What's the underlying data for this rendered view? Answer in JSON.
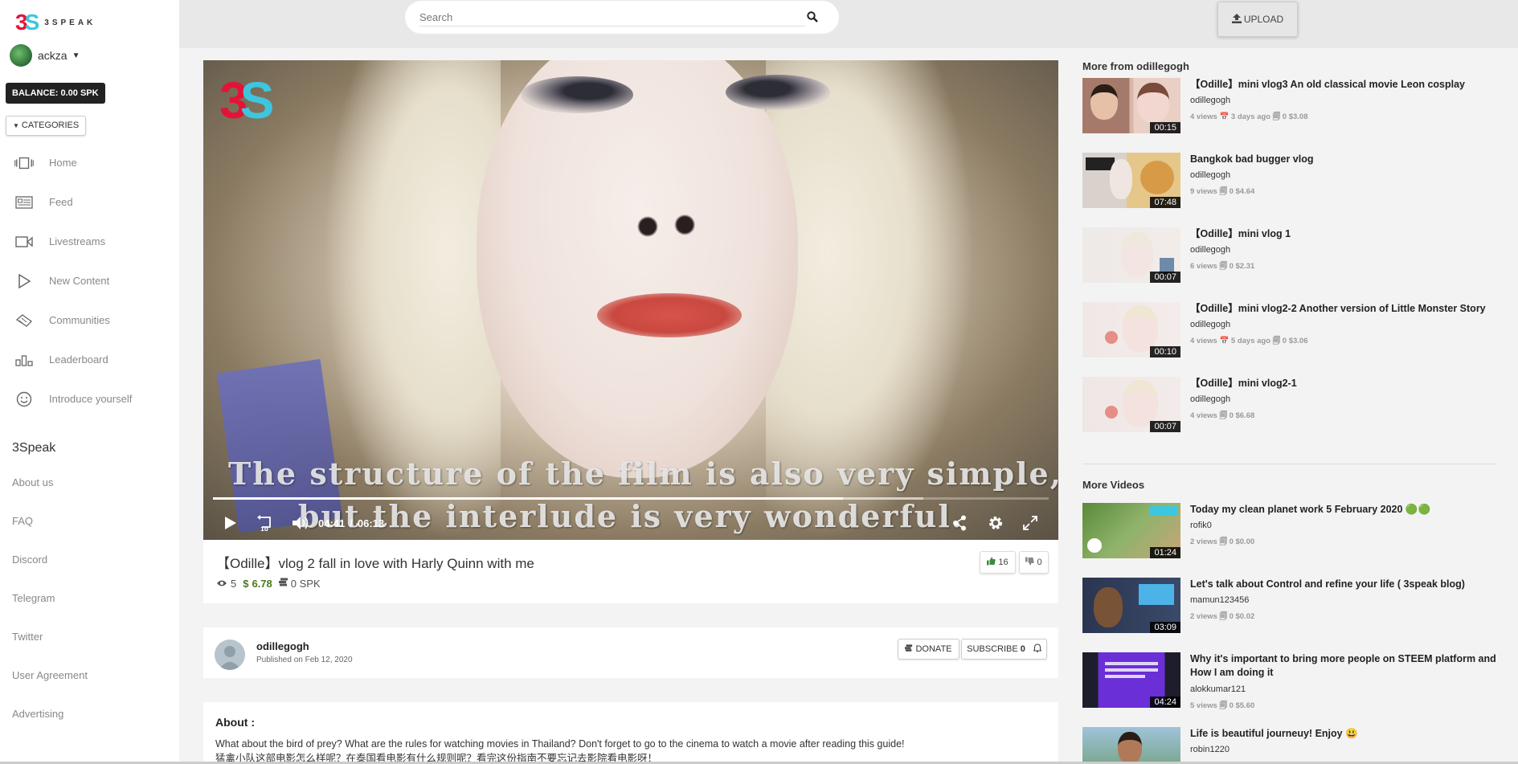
{
  "app": {
    "logo_text": "3SPEAK"
  },
  "user": {
    "name": "ackza"
  },
  "balance_label": "BALANCE: 0.00 SPK",
  "categories_label": "CATEGORIES",
  "nav": [
    {
      "label": "Home",
      "icon": "home-icon"
    },
    {
      "label": "Feed",
      "icon": "feed-icon"
    },
    {
      "label": "Livestreams",
      "icon": "video-camera-icon"
    },
    {
      "label": "New Content",
      "icon": "play-icon"
    },
    {
      "label": "Communities",
      "icon": "communities-icon"
    },
    {
      "label": "Leaderboard",
      "icon": "leaderboard-icon"
    },
    {
      "label": "Introduce yourself",
      "icon": "smiley-icon"
    }
  ],
  "footer": {
    "title": "3Speak",
    "links": [
      "About us",
      "FAQ",
      "Discord",
      "Telegram",
      "Twitter",
      "User Agreement",
      "Advertising"
    ]
  },
  "search": {
    "placeholder": "Search"
  },
  "upload_label": "UPLOAD",
  "player": {
    "subtitle_line1": "The structure of the film is also very simple,",
    "subtitle_line2": "but the interlude is very wonderful.",
    "current_time": "04:41",
    "separator": "/",
    "duration": "06:13",
    "played_fraction": 0.754,
    "buffered_fraction": 0.85
  },
  "video": {
    "title": "【Odille】vlog 2 fall in love with Harly Quinn with me",
    "views": "5",
    "earnings": "6.78",
    "spk": "0 SPK",
    "likes": "16",
    "dislikes": "0"
  },
  "channel": {
    "name": "odillegogh",
    "published": "Published on Feb 12, 2020",
    "donate_label": "DONATE",
    "subscribe_label": "SUBSCRIBE",
    "subscribe_count": "0"
  },
  "about": {
    "title": "About :",
    "line1": "What about the bird of prey? What are the rules for watching movies in Thailand? Don't forget to go to the cinema to watch a movie after reading this guide!",
    "line2": "猛禽小队这部电影怎么样呢？在泰国看电影有什么规则呢？看完这份指南不要忘记去影院看电影呀！"
  },
  "more_from": {
    "title": "More from odillegogh",
    "videos": [
      {
        "title": "【Odille】mini vlog3 An old classical movie Leon cosplay",
        "author": "odillegogh",
        "meta": "4 views 📅 3 days ago 🗐 0  $3.08",
        "duration": "00:15"
      },
      {
        "title": "Bangkok bad bugger vlog",
        "author": "odillegogh",
        "meta": "9 views 🗐 0  $4.64",
        "duration": "07:48"
      },
      {
        "title": "【Odille】mini vlog 1",
        "author": "odillegogh",
        "meta": "6 views 🗐 0  $2.31",
        "duration": "00:07"
      },
      {
        "title": "【Odille】mini vlog2-2 Another version of Little Monster Story",
        "author": "odillegogh",
        "meta": "4 views 📅 5 days ago 🗐 0  $3.06",
        "duration": "00:10"
      },
      {
        "title": "【Odille】mini vlog2-1",
        "author": "odillegogh",
        "meta": "4 views 🗐 0  $6.68",
        "duration": "00:07"
      }
    ]
  },
  "more_videos": {
    "title": "More Videos",
    "videos": [
      {
        "title": "Today my clean planet work 5 February 2020 🟢🟢",
        "author": "rofik0",
        "meta": "2 views 🗐 0  $0.00",
        "duration": "01:24"
      },
      {
        "title": "Let's talk about Control and refine your life ( 3speak blog)",
        "author": "mamun123456",
        "meta": "2 views 🗐 0  $0.02",
        "duration": "03:09"
      },
      {
        "title": "Why it's important to bring more people on STEEM platform and How I am doing it",
        "author": "alokkumar121",
        "meta": "5 views 🗐 0  $5.60",
        "duration": "04:24"
      },
      {
        "title": "Life is beautiful journeuy! Enjoy 😃",
        "author": "robin1220",
        "meta": "",
        "duration": ""
      }
    ]
  },
  "colors": {
    "accent_red": "#e31337",
    "accent_cyan": "#3ec6de",
    "money_green": "#4a7a1c"
  }
}
